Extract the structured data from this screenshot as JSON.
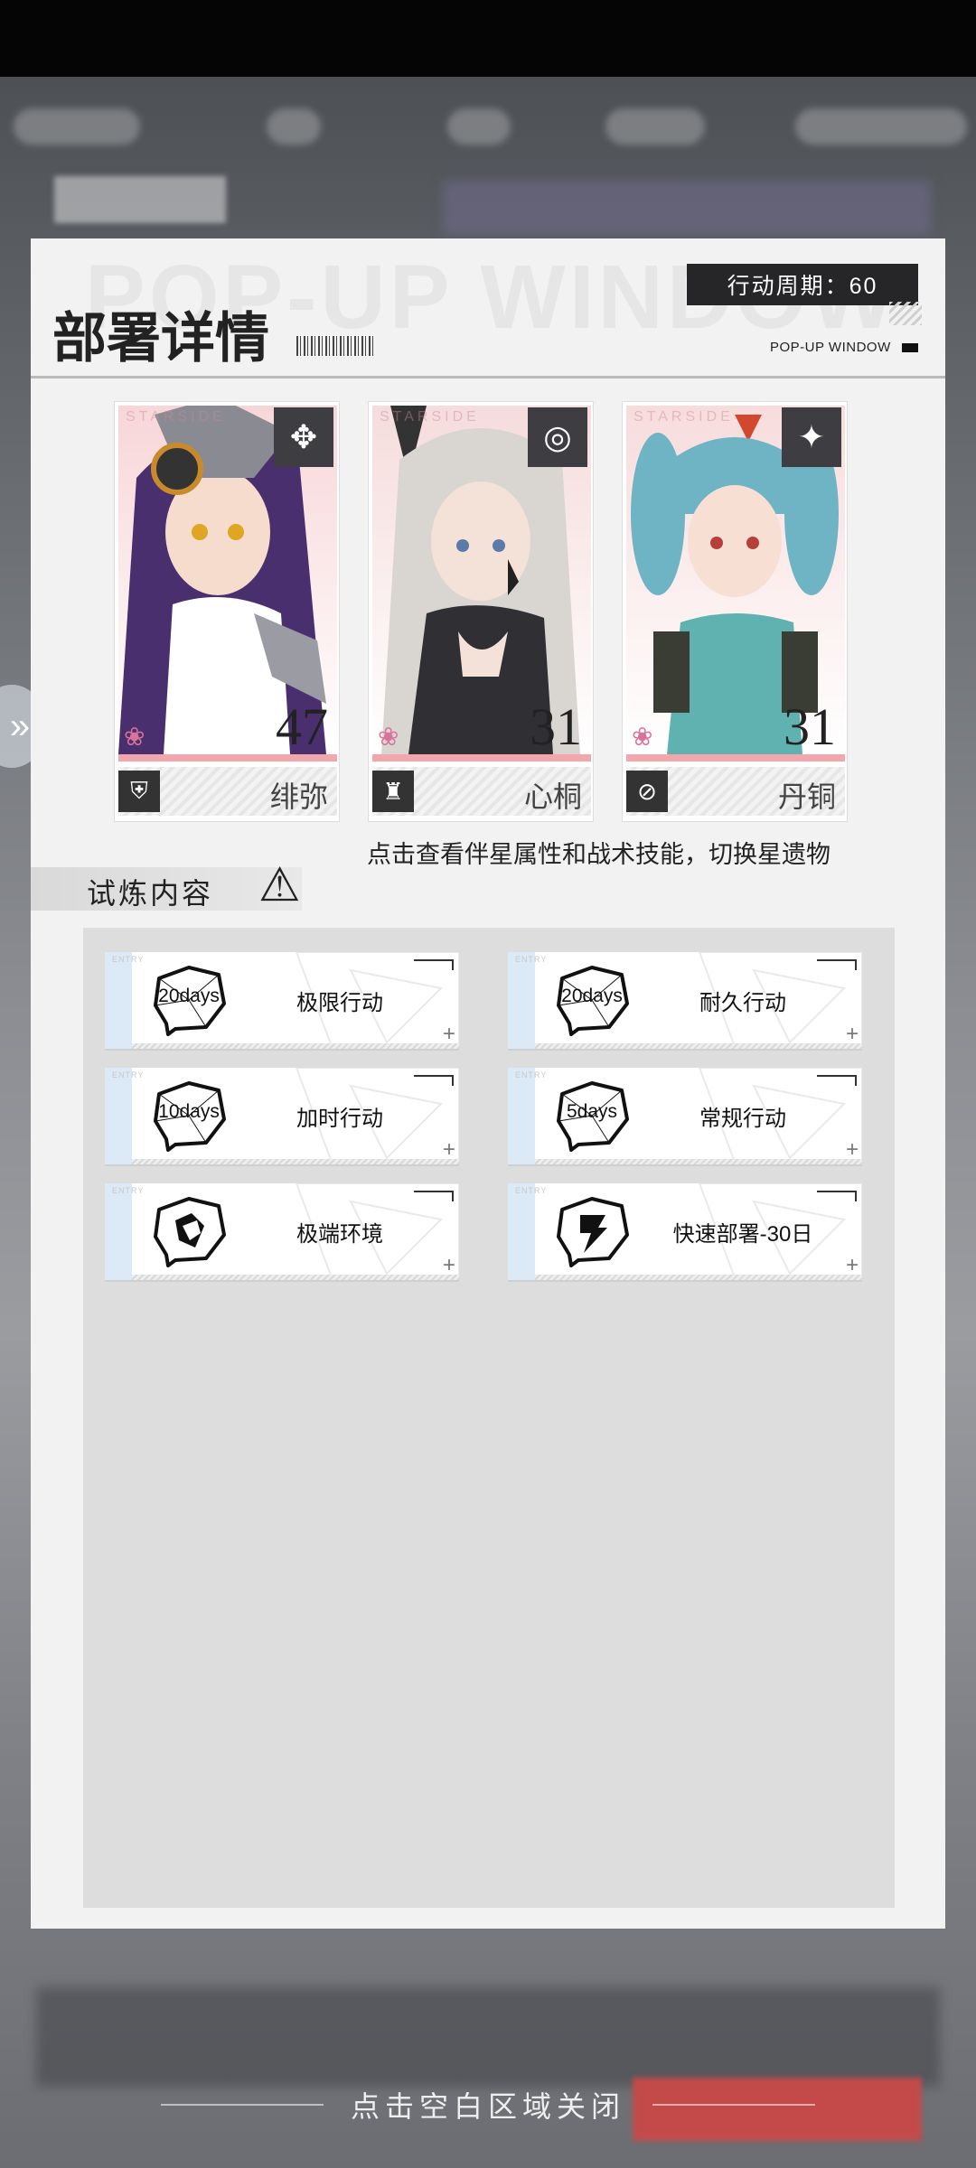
{
  "popup": {
    "title": "部署详情",
    "watermark": "POP-UP WINDOW",
    "subtitle": "POP-UP WINDOW",
    "cycle": "行动周期：60"
  },
  "characters": [
    {
      "name": "绯弥",
      "level": "47",
      "hair": "#4a2f6e",
      "skin": "#f5dccd",
      "bg": "#f8d6d8",
      "emblem": "✥",
      "icon": "⛨"
    },
    {
      "name": "心桐",
      "level": "31",
      "hair": "#d9d6d2",
      "skin": "#f4e2d8",
      "bg": "#f6dcdc",
      "emblem": "◎",
      "icon": "♜"
    },
    {
      "name": "丹铜",
      "level": "31",
      "hair": "#6fb4c4",
      "skin": "#f7dfd3",
      "bg": "#f8dcdc",
      "emblem": "✦",
      "icon": "⊘"
    }
  ],
  "card_mark": "STARSIDE",
  "hint": "点击查看伴星属性和战术技能，切换星遗物",
  "section": {
    "label": "试炼内容",
    "icon": "warning-icon"
  },
  "entries": [
    {
      "label": "极限行动",
      "days": "20days",
      "icon": "speech-bubble-icon"
    },
    {
      "label": "耐久行动",
      "days": "20days",
      "icon": "speech-bubble-icon"
    },
    {
      "label": "加时行动",
      "days": "10days",
      "icon": "speech-bubble-icon"
    },
    {
      "label": "常规行动",
      "days": "5days",
      "icon": "speech-bubble-icon"
    },
    {
      "label": "极端环境",
      "days": "",
      "icon": "shield-bubble-icon"
    },
    {
      "label": "快速部署-30日",
      "days": "",
      "icon": "lightning-bubble-icon"
    }
  ],
  "entry_tag": "ENTRY",
  "dismiss": "点击空白区域关闭",
  "colors": {
    "accent_pink": "#f1a7ab",
    "entry_bar": "#dbeaf6",
    "dark": "#262628"
  }
}
